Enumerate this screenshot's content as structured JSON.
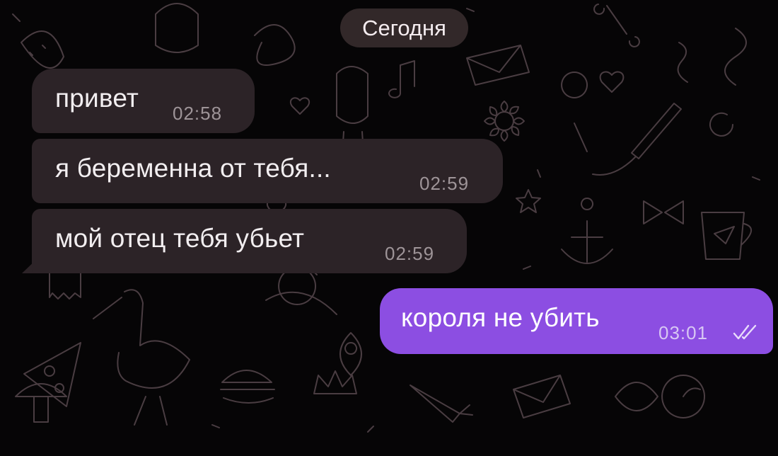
{
  "date_separator": "Сегодня",
  "messages": [
    {
      "text": "привет",
      "time": "02:58",
      "direction": "incoming"
    },
    {
      "text": "я беременна от тебя...",
      "time": "02:59",
      "direction": "incoming"
    },
    {
      "text": "мой отец тебя убьет",
      "time": "02:59",
      "direction": "incoming"
    },
    {
      "text": "короля не убить",
      "time": "03:01",
      "direction": "outgoing",
      "status": "read"
    }
  ],
  "colors": {
    "background": "#060506",
    "incoming_bubble": "#2c2327",
    "outgoing_bubble": "#8c4ee2",
    "wallpaper_lines": "#4a3d42"
  },
  "icons": [
    "double-check-icon"
  ]
}
